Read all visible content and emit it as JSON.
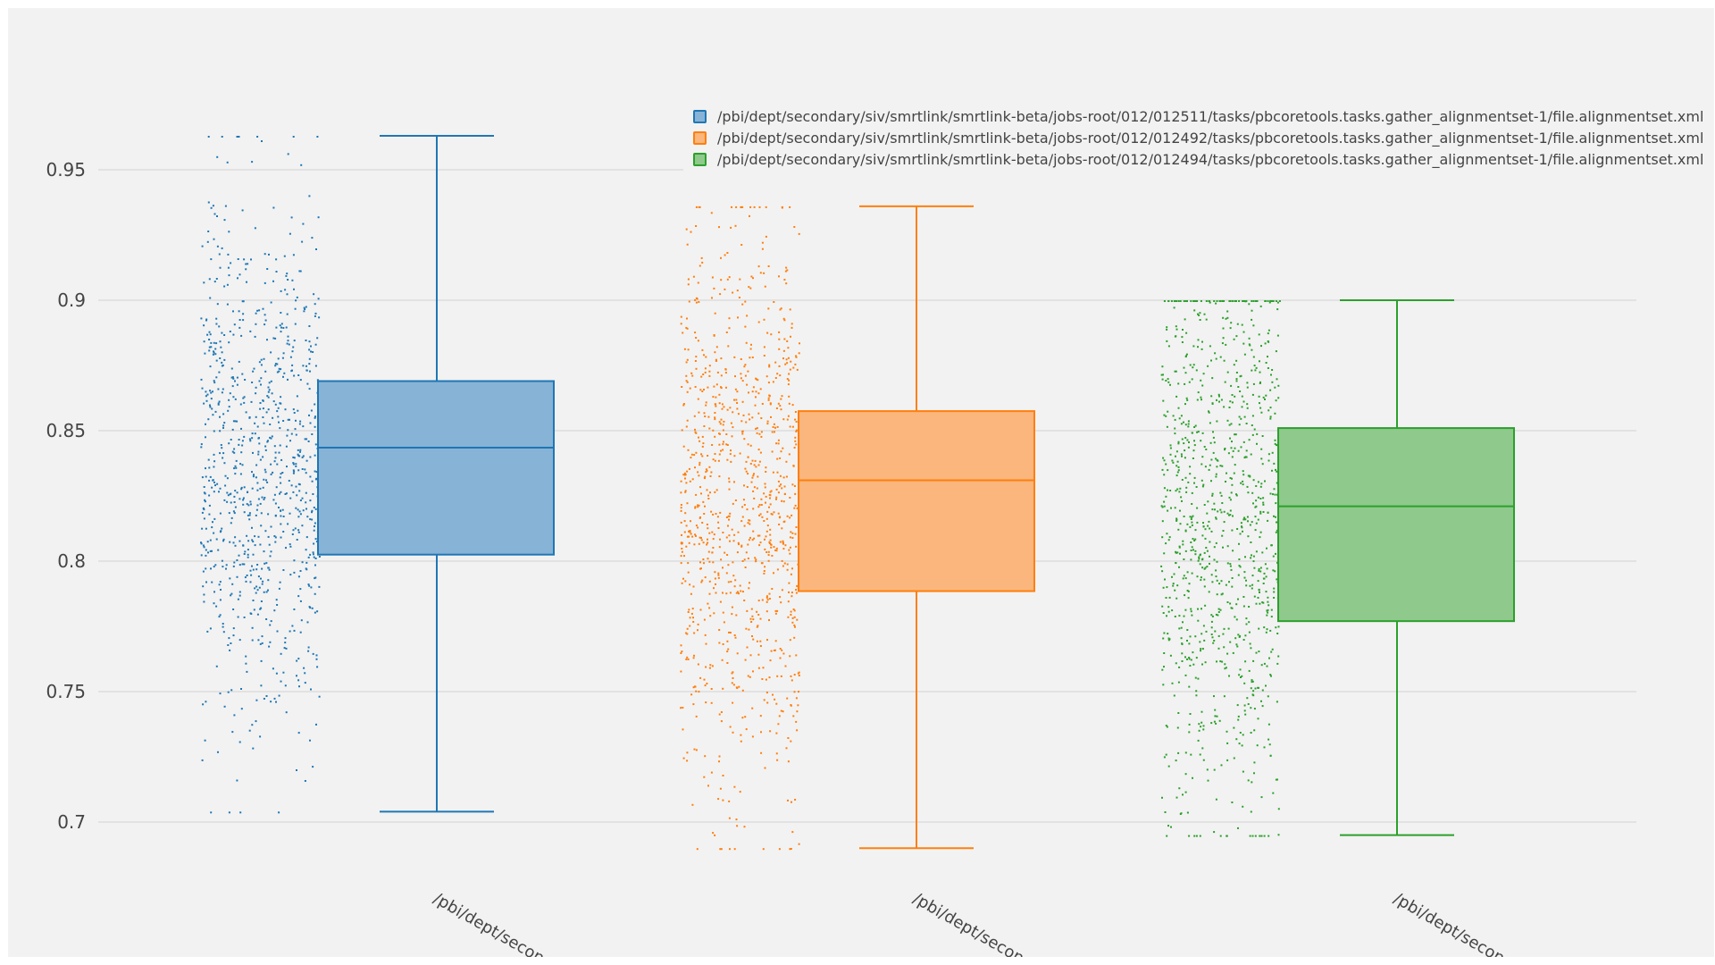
{
  "chart_data": {
    "type": "box",
    "title": "",
    "xlabel": "",
    "ylabel": "",
    "ylim": [
      0.688,
      0.995
    ],
    "yticks": [
      {
        "value": 0.7,
        "label": "0.7"
      },
      {
        "value": 0.75,
        "label": "0.75"
      },
      {
        "value": 0.8,
        "label": "0.8"
      },
      {
        "value": 0.85,
        "label": "0.85"
      },
      {
        "value": 0.9,
        "label": "0.9"
      },
      {
        "value": 0.95,
        "label": "0.95"
      }
    ],
    "grid": true,
    "boxpoints": "all",
    "legend_position": "top-right",
    "series": [
      {
        "name": "/pbi/dept/secondary/siv/smrtlink/smrtlink-beta/jobs-root/012/012511/tasks/pbcoretools.tasks.gather_alignmentset-1/file.alignmentset.xml",
        "category_label": "/pbi/dept/second",
        "color": "#1f77b4",
        "fill": "#87b3d6",
        "n_points": 900,
        "min": 0.704,
        "q1": 0.8025,
        "median": 0.8435,
        "q3": 0.869,
        "max": 0.963
      },
      {
        "name": "/pbi/dept/secondary/siv/smrtlink/smrtlink-beta/jobs-root/012/012492/tasks/pbcoretools.tasks.gather_alignmentset-1/file.alignmentset.xml",
        "category_label": "/pbi/dept/second",
        "color": "#ff7f0e",
        "fill": "#fab67c",
        "n_points": 1000,
        "min": 0.69,
        "q1": 0.7885,
        "median": 0.831,
        "q3": 0.8575,
        "max": 0.936
      },
      {
        "name": "/pbi/dept/secondary/siv/smrtlink/smrtlink-beta/jobs-root/012/012494/tasks/pbcoretools.tasks.gather_alignmentset-1/file.alignmentset.xml",
        "category_label": "/pbi/dept/second",
        "color": "#2ca02c",
        "fill": "#8fc98c",
        "n_points": 1000,
        "min": 0.695,
        "q1": 0.777,
        "median": 0.821,
        "q3": 0.851,
        "max": 0.9
      }
    ]
  }
}
